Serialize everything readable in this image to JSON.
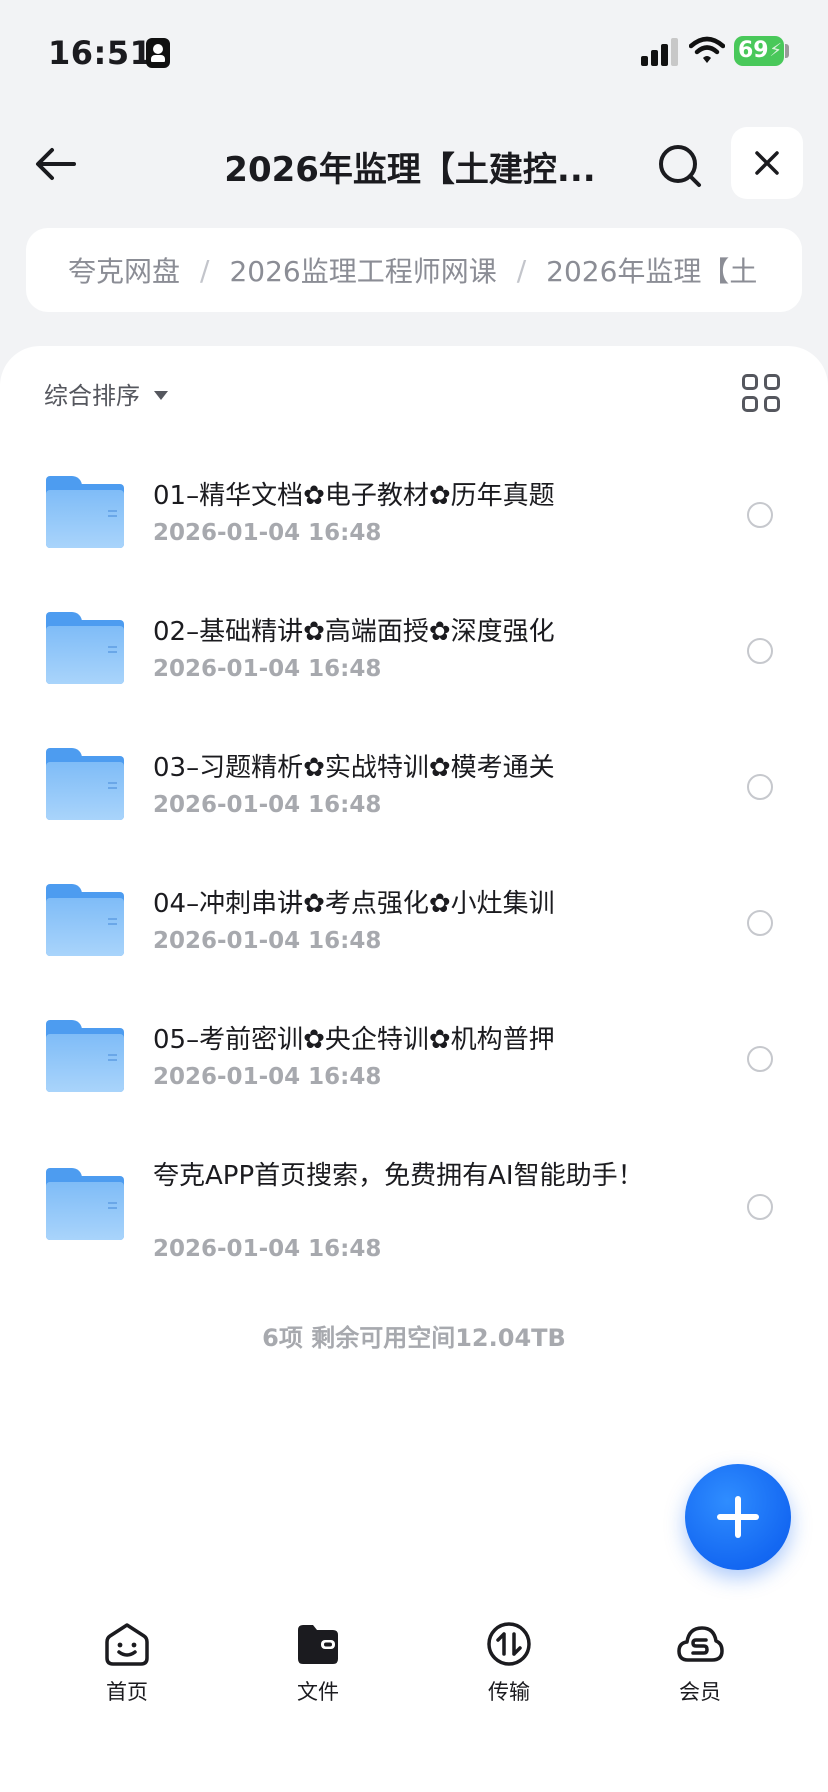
{
  "status_bar": {
    "time": "16:51",
    "battery": "69"
  },
  "header": {
    "title": "2026年监理【土建控..."
  },
  "breadcrumb": [
    "夸克网盘",
    "2026监理工程师网课",
    "2026年监理【土"
  ],
  "breadcrumb_separator": "/",
  "toolbar": {
    "sort_label": "综合排序"
  },
  "files": [
    {
      "name": "01–精华文档✿电子教材✿历年真题",
      "date": "2026-01-04 16:48"
    },
    {
      "name": "02–基础精讲✿高端面授✿深度强化",
      "date": "2026-01-04 16:48"
    },
    {
      "name": "03–习题精析✿实战特训✿模考通关",
      "date": "2026-01-04 16:48"
    },
    {
      "name": "04–冲刺串讲✿考点强化✿小灶集训",
      "date": "2026-01-04 16:48"
    },
    {
      "name": "05–考前密训✿央企特训✿机构普押",
      "date": "2026-01-04 16:48"
    },
    {
      "name": "夸克APP首页搜索，免费拥有AI智能助手！",
      "date": "2026-01-04 16:48"
    }
  ],
  "summary": "6项 剩余可用空间12.04TB",
  "tabs": [
    {
      "label": "首页",
      "icon": "home-smile-icon"
    },
    {
      "label": "文件",
      "icon": "folder-icon"
    },
    {
      "label": "传输",
      "icon": "transfer-icon"
    },
    {
      "label": "会员",
      "icon": "member-cloud-icon"
    }
  ],
  "colors": {
    "accent": "#1468f2",
    "folder": "#7fbcf7",
    "battery": "#49c85a"
  }
}
